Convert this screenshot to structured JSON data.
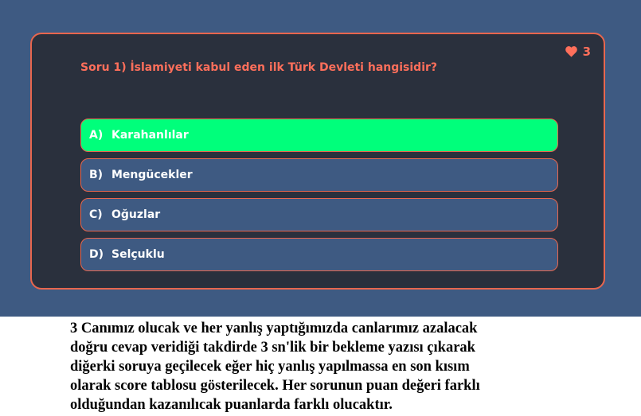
{
  "quiz": {
    "lives": "3",
    "question": "Soru 1) İslamiyeti kabul eden ilk Türk Devleti hangisidir?",
    "answers": [
      {
        "letter": "A)",
        "text": "Karahanlılar",
        "state": "correct"
      },
      {
        "letter": "B)",
        "text": "Mengücekler"
      },
      {
        "letter": "C)",
        "text": "Oğuzlar"
      },
      {
        "letter": "D)",
        "text": "Selçuklu"
      }
    ]
  },
  "note": {
    "lines": [
      "3 Canımız olucak ve her yanlış yaptığımızda canlarımız azalacak",
      "doğru cevap veridiği takdirde 3 sn'lik bir bekleme yazısı çıkarak",
      "diğerki soruya geçilecek eğer hiç yanlış yapılmassa en son kısım",
      "olarak score tablosu gösterilecek. Her sorunun puan değeri farklı",
      "olduğundan kazanılıcak puanlarda farklı olucaktır."
    ]
  },
  "colors": {
    "background": "#3e5a82",
    "card": "#2a303d",
    "accent": "#ff6f5b",
    "correct": "#00ff7b"
  },
  "icons": {
    "lives": "heart-icon"
  }
}
